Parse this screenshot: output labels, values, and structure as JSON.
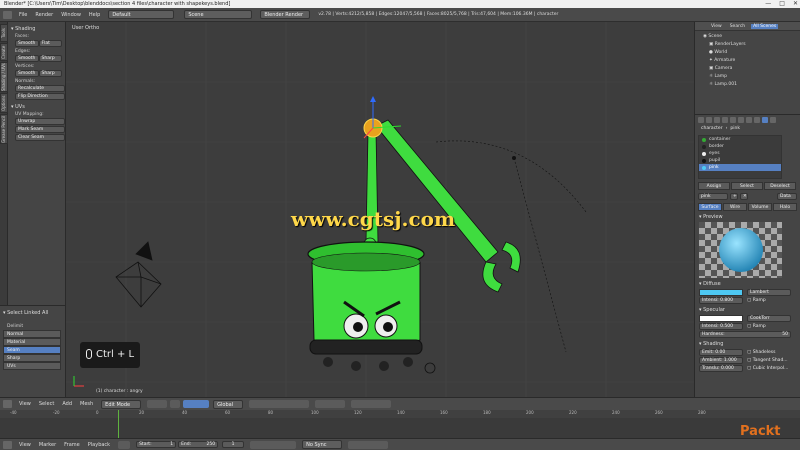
{
  "titlebar": {
    "text": "Blender* [C:\\Users\\Tim\\Desktop\\blenddocs\\section 4 files\\character with shapekeys.blend]"
  },
  "topheader": {
    "menus": [
      "File",
      "Render",
      "Window",
      "Help"
    ],
    "layout": "Default",
    "scene": "Scene",
    "engine": "Blender Render",
    "stats": "v2.78 | Verts:4212/5,858 | Edges:12047/5,568 | Faces:8025/5,768 | Tris:47,604 | Mem:106.36M | character"
  },
  "lefttabs": [
    "Tools",
    "Create",
    "Shading / UVs",
    "Options",
    "Grease Pencil"
  ],
  "toolshelf": {
    "title": "Shading",
    "faces_label": "Faces:",
    "edges_label": "Edges:",
    "vertices_label": "Vertices:",
    "smooth": "Smooth",
    "flat": "Flat",
    "sharp": "Sharp",
    "normals_label": "Normals:",
    "recalculate": "Recalculate",
    "flip_direction": "Flip Direction",
    "uvs_title": "UVs",
    "uv_mapping_label": "UV Mapping:",
    "unwrap": "Unwrap",
    "mark_seam": "Mark Seam",
    "clear_seam": "Clear Seam"
  },
  "lastop": {
    "title": "Select Linked All",
    "delimit_label": "Delimit",
    "items": [
      "Normal",
      "Material",
      "Seam",
      "Sharp",
      "UVs"
    ],
    "active": "Seam"
  },
  "viewport": {
    "label": "User Ortho",
    "status": "(1) character : angry",
    "hint": "Ctrl + L",
    "watermark": "www.cgtsj.com"
  },
  "outliner": {
    "tabs": [
      "View",
      "Search",
      "All Scenes"
    ],
    "items": [
      "Scene",
      "RenderLayers",
      "World",
      "Armature",
      "Camera",
      "Lamp",
      "Lamp.001"
    ]
  },
  "props": {
    "breadcrumb": "character",
    "breadcrumb2": "pink",
    "materials": [
      "container",
      "border",
      "eyes",
      "pupil",
      "pink"
    ],
    "active_material": "pink",
    "assign": "Assign",
    "select": "Select",
    "deselect": "Deselect",
    "matname": "pink",
    "data": "Data",
    "shade_tabs": [
      "Surface",
      "Wire",
      "Volume",
      "Halo"
    ],
    "preview": "Preview",
    "diffuse": "Diffuse",
    "lambert": "Lambert",
    "intensity": "Intensi: 0.800",
    "ramp": "Ramp",
    "specular": "Specular",
    "cooktorr": "CookTorr",
    "spec_intensity": "Intensi: 0.500",
    "hardness": "Hardness:",
    "hardness_val": "50",
    "shading": "Shading",
    "emit": "Emit: 0.00",
    "shadeless": "Shadeless",
    "ambient": "Ambient: 1.000",
    "tangent": "Tangent Shad...",
    "transl": "Translu: 0.000",
    "cubic": "Cubic Interpol...",
    "colors": {
      "diffuse": "#4ec8f2",
      "specular": "#ffffff"
    }
  },
  "vpheader": {
    "menus": [
      "View",
      "Select",
      "Add",
      "Mesh"
    ],
    "mode": "Edit Mode",
    "pivot": "Global"
  },
  "timeline": {
    "ticks": [
      "-40",
      "-20",
      "0",
      "20",
      "40",
      "60",
      "80",
      "100",
      "120",
      "140",
      "160",
      "180",
      "200",
      "220",
      "240",
      "260",
      "280"
    ],
    "menus": [
      "View",
      "Marker",
      "Frame",
      "Playback"
    ],
    "start": "Start:",
    "start_val": "1",
    "end": "End:",
    "end_val": "250",
    "current": "1",
    "sync": "No Sync"
  },
  "brand": "Packt"
}
